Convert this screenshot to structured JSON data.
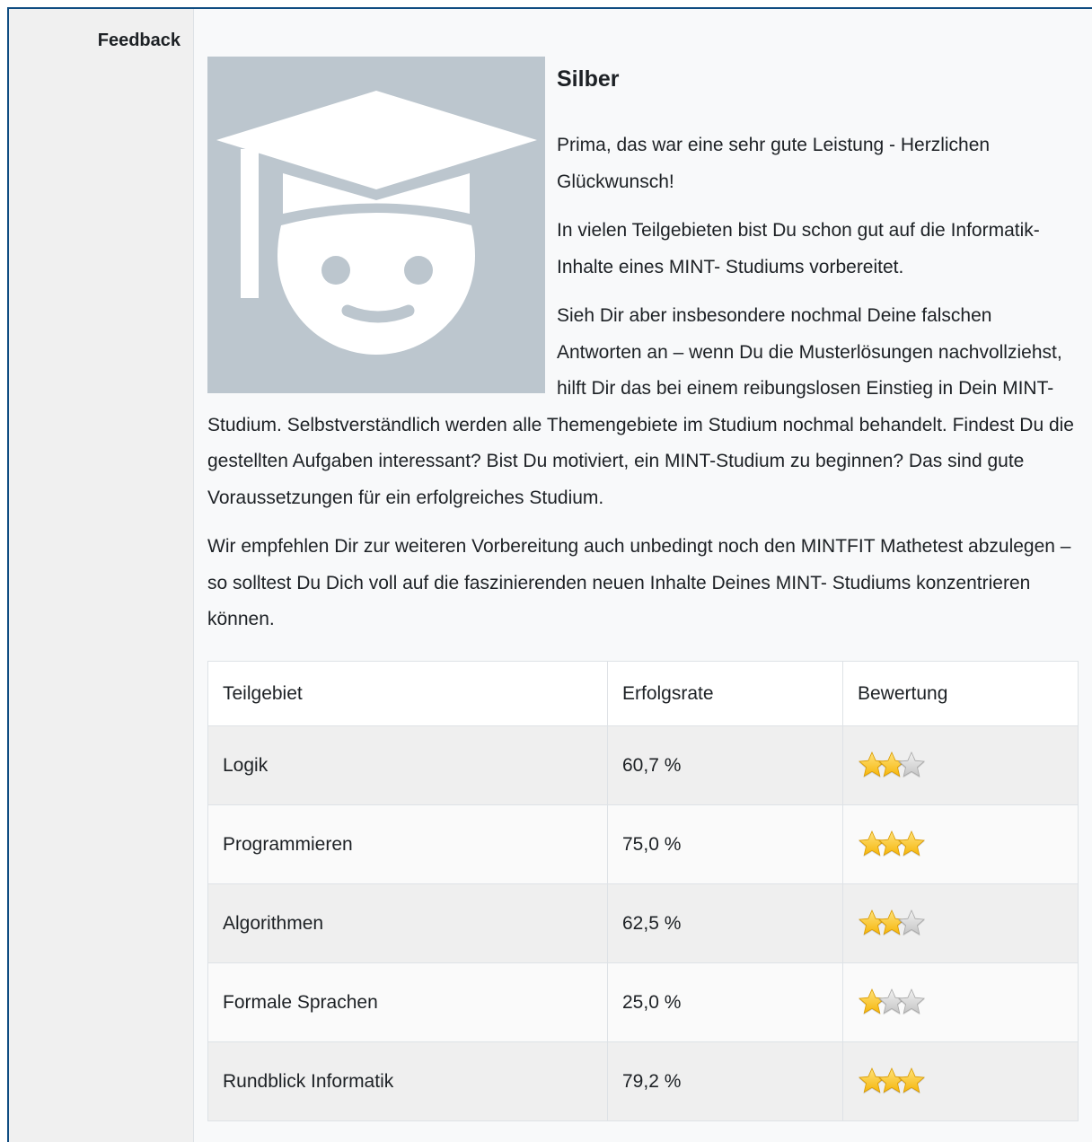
{
  "field_label": "Feedback",
  "feedback": {
    "title": "Silber",
    "paragraphs": [
      "Prima, das war eine sehr gute Leistung - Herzlichen Glückwunsch!",
      "In vielen Teilgebieten bist Du schon gut auf die Informatik-Inhalte eines MINT- Studiums vorbereitet.",
      "Sieh Dir aber insbesondere nochmal Deine falschen Antworten an – wenn Du die Musterlösungen nachvollziehst, hilft Dir das bei einem reibungslosen Einstieg in Dein MINT-Studium. Selbstverständlich werden alle Themengebiete im Studium nochmal behandelt. Findest Du die gestellten Aufgaben interessant? Bist Du motiviert, ein MINT-Studium zu beginnen? Das sind gute Voraussetzungen für ein erfolgreiches Studium.",
      "Wir empfehlen Dir zur weiteren Vorbereitung auch unbedingt noch den MINTFIT Mathetest abzulegen – so solltest Du Dich voll auf die faszinierenden neuen Inhalte Deines MINT- Studiums konzentrieren können."
    ],
    "image_icon": "graduate-cap-smiley-icon",
    "colors": {
      "image_bg": "#bcc6ce",
      "frame_border": "#0f4c81",
      "star_gold": "#f5b60c",
      "star_silver": "#c4c4c4"
    }
  },
  "table": {
    "headers": [
      "Teilgebiet",
      "Erfolgsrate",
      "Bewertung"
    ],
    "rows": [
      {
        "teilgebiet": "Logik",
        "erfolgsrate": "60,7 %",
        "stars_gold": 2,
        "stars_total": 3
      },
      {
        "teilgebiet": "Programmieren",
        "erfolgsrate": "75,0 %",
        "stars_gold": 3,
        "stars_total": 3
      },
      {
        "teilgebiet": "Algorithmen",
        "erfolgsrate": "62,5 %",
        "stars_gold": 2,
        "stars_total": 3
      },
      {
        "teilgebiet": "Formale Sprachen",
        "erfolgsrate": "25,0 %",
        "stars_gold": 1,
        "stars_total": 3
      },
      {
        "teilgebiet": "Rundblick Informatik",
        "erfolgsrate": "79,2 %",
        "stars_gold": 3,
        "stars_total": 3
      }
    ]
  }
}
